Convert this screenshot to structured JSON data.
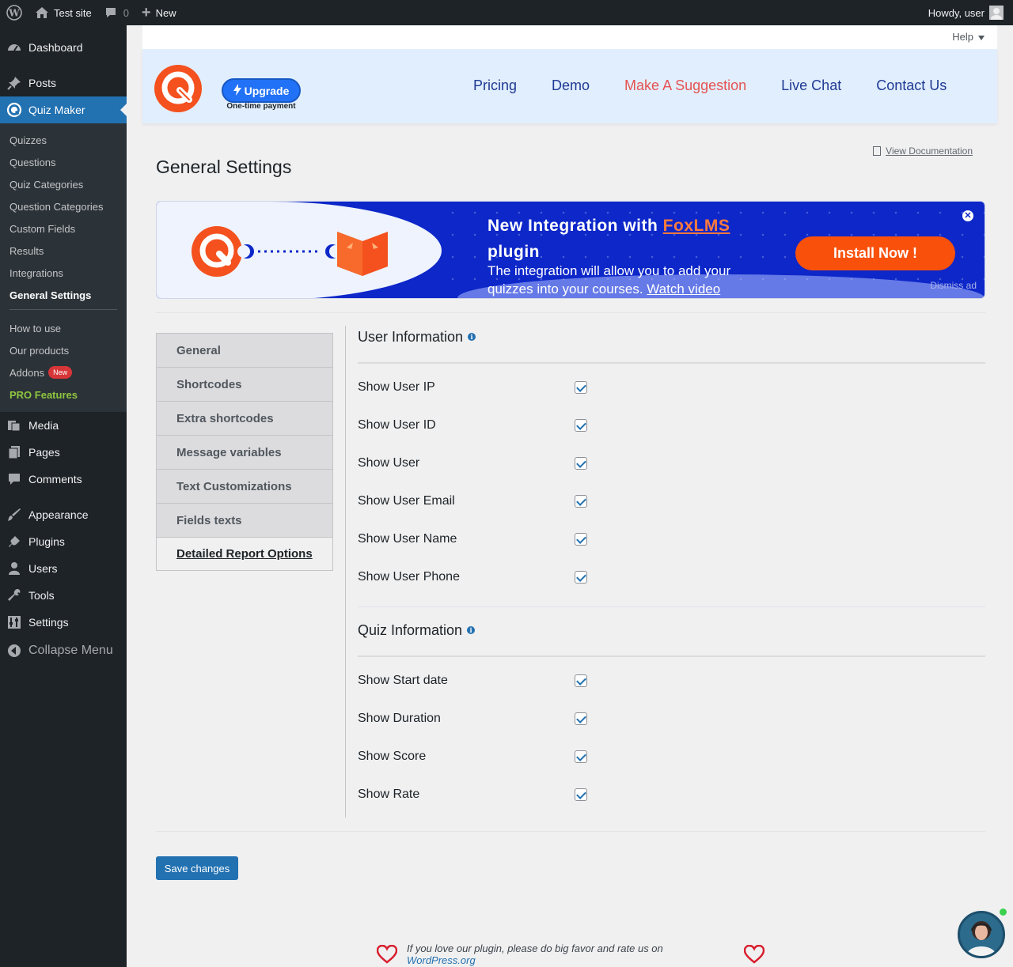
{
  "adminbar": {
    "site_name": "Test site",
    "comments_count": "0",
    "new_label": "New",
    "howdy": "Howdy, user"
  },
  "sidebar": {
    "items_top": [
      {
        "label": "Dashboard",
        "icon": "dashboard-icon"
      },
      {
        "label": "Posts",
        "icon": "pin-icon"
      }
    ],
    "quiz_maker": "Quiz Maker",
    "submenu": [
      "Quizzes",
      "Questions",
      "Quiz Categories",
      "Question Categories",
      "Custom Fields",
      "Results",
      "Integrations",
      "General Settings"
    ],
    "submenu2": [
      "How to use",
      "Our products",
      "Addons"
    ],
    "addons_badge": "New",
    "pro_features": "PRO Features",
    "items_bottom": [
      {
        "label": "Media",
        "icon": "media-icon"
      },
      {
        "label": "Pages",
        "icon": "pages-icon"
      },
      {
        "label": "Comments",
        "icon": "comment-icon"
      },
      {
        "label": "Appearance",
        "icon": "brush-icon"
      },
      {
        "label": "Plugins",
        "icon": "plug-icon"
      },
      {
        "label": "Users",
        "icon": "user-icon"
      },
      {
        "label": "Tools",
        "icon": "wrench-icon"
      },
      {
        "label": "Settings",
        "icon": "settings-icon"
      }
    ],
    "collapse": "Collapse Menu"
  },
  "help": "Help",
  "header": {
    "upgrade": "Upgrade",
    "one_time": "One-time payment",
    "nav": [
      "Pricing",
      "Demo",
      "Make A Suggestion",
      "Live Chat",
      "Contact Us"
    ]
  },
  "page": {
    "title": "General Settings",
    "view_doc": "View Documentation"
  },
  "banner": {
    "title_pre": "New Integration with ",
    "title_link": "FoxLMS",
    "title_post": " plugin",
    "desc": "The integration will allow you to add your quizzes into your courses. ",
    "watch": "Watch video",
    "install": "Install Now !",
    "dismiss": "Dismiss ad",
    "colors": {
      "bg": "#0d27c9",
      "button": "#f9510c",
      "link": "#ff7a3d"
    }
  },
  "tabs": [
    "General",
    "Shortcodes",
    "Extra shortcodes",
    "Message variables",
    "Text Customizations",
    "Fields texts",
    "Detailed Report Options"
  ],
  "user_info": {
    "title": "User Information",
    "rows": [
      "Show User IP",
      "Show User ID",
      "Show User",
      "Show User Email",
      "Show User Name",
      "Show User Phone"
    ]
  },
  "quiz_info": {
    "title": "Quiz Information",
    "rows": [
      "Show Start date",
      "Show Duration",
      "Show Score",
      "Show Rate"
    ]
  },
  "save": "Save changes",
  "footer": {
    "text": "If you love our plugin, please do big favor and rate us on ",
    "link": "WordPress.org"
  }
}
